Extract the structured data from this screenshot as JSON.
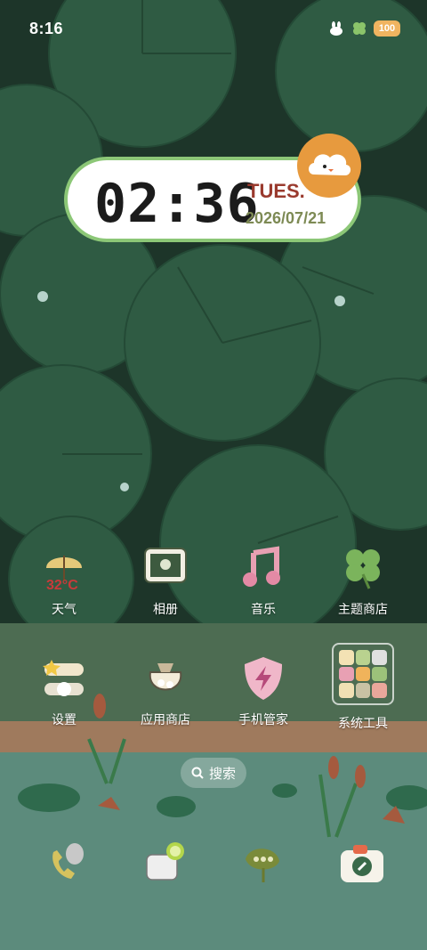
{
  "status_bar": {
    "time": "8:16",
    "battery": "100"
  },
  "clock_widget": {
    "time": "02:36",
    "day": "TUES.",
    "date": "2026/07/21"
  },
  "apps_row1": [
    {
      "label": "天气",
      "icon": "umbrella-weather-icon",
      "temp": "32°C"
    },
    {
      "label": "相册",
      "icon": "photo-frame-icon"
    },
    {
      "label": "音乐",
      "icon": "music-note-icon"
    },
    {
      "label": "主题商店",
      "icon": "clover-icon"
    }
  ],
  "apps_row2": [
    {
      "label": "设置",
      "icon": "settings-toggle-icon"
    },
    {
      "label": "应用商店",
      "icon": "bag-store-icon"
    },
    {
      "label": "手机管家",
      "icon": "shield-bolt-icon"
    },
    {
      "label": "系统工具",
      "icon": "tools-folder-icon"
    }
  ],
  "search": {
    "label": "搜索"
  },
  "dock": [
    "phone-icon",
    "messages-icon",
    "browser-icon",
    "camera-icon"
  ],
  "colors": {
    "clock_border": "#8cc777",
    "clock_day": "#9a3a2e",
    "clock_date": "#7d8a54",
    "badge": "#e79a3e",
    "battery": "#f0b460"
  }
}
